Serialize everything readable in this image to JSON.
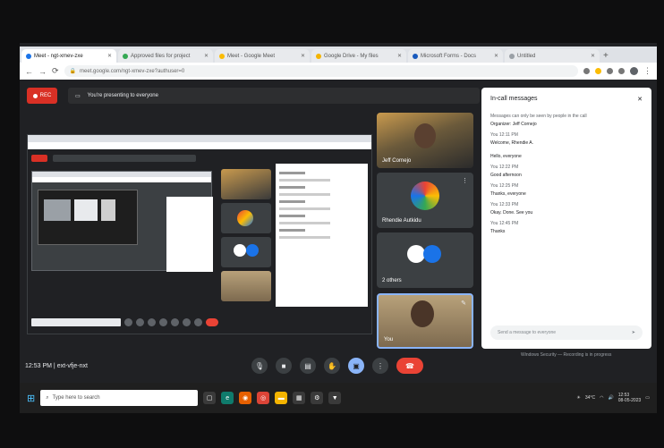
{
  "browser": {
    "tabs": [
      {
        "label": "Meet - ngt-xmev-zxe",
        "active": true
      },
      {
        "label": "Approved files for project",
        "active": false
      },
      {
        "label": "Meet - Google Meet",
        "active": false
      },
      {
        "label": "Google Drive - My files",
        "active": false
      },
      {
        "label": "Microsoft Forms - Docs",
        "active": false
      },
      {
        "label": "Untitled",
        "active": false
      }
    ],
    "address": "meet.google.com/ngt-xmev-zxe?authuser=0"
  },
  "meeting": {
    "rec_label": "REC",
    "notice": "You're presenting to everyone",
    "time": "12:53 PM",
    "meeting_code": "ext-vfje-nxt",
    "participants": [
      {
        "name": "Jeff Cornejo"
      },
      {
        "name": "Rhendie Autkidu"
      },
      {
        "name": "2 others"
      },
      {
        "name": "You"
      }
    ]
  },
  "chat": {
    "title": "In-call messages",
    "messages": [
      {
        "who": "Messages can only be seen by people in the call",
        "text": "Organizer: Jeff Cornejo"
      },
      {
        "who": "You  12:11 PM",
        "text": "Welcome, Rhendie A."
      },
      {
        "who": "",
        "text": "Hello, everyone"
      },
      {
        "who": "You  12:22 PM",
        "text": "Good afternoon"
      },
      {
        "who": "You  12:25 PM",
        "text": "Thanks, everyone"
      },
      {
        "who": "You  12:33 PM",
        "text": "Okay. Done. See you"
      },
      {
        "who": "You  12:45 PM",
        "text": "Thanks"
      }
    ],
    "input_placeholder": "Send a message to everyone"
  },
  "notification": "Windows Security — Recording is in progress",
  "taskbar": {
    "search_placeholder": "Type here to search",
    "weather": "34°C",
    "clock_time": "12:53",
    "clock_date": "08-05-2023"
  },
  "colors": {
    "accent": "#8ab4f8",
    "end_call": "#ea4335",
    "rec": "#d93025"
  }
}
